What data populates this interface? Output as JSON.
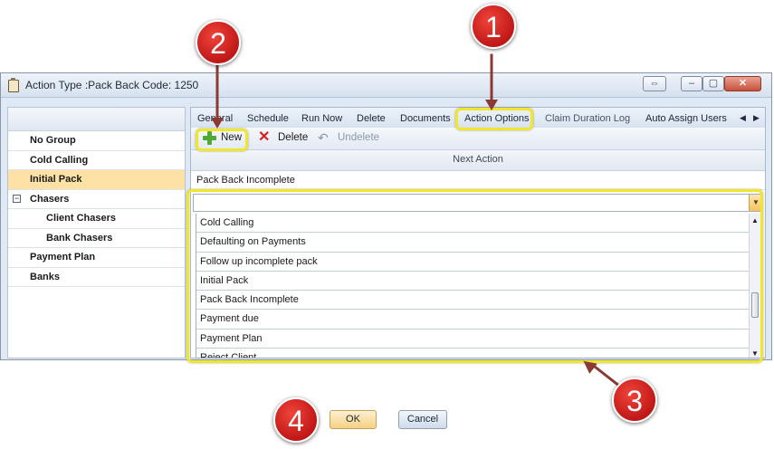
{
  "window": {
    "title": "Action Type :Pack Back Code: 1250"
  },
  "title_buttons": {
    "resize": "⇔",
    "minimize": "–",
    "maximize": "▢",
    "close": "✕"
  },
  "sidebar": {
    "items": [
      {
        "label": "No Group",
        "level": 0,
        "selected": false
      },
      {
        "label": "Cold Calling",
        "level": 0,
        "selected": false
      },
      {
        "label": "Initial Pack",
        "level": 0,
        "selected": true
      },
      {
        "label": "Chasers",
        "level": 0,
        "selected": false,
        "expanded": true
      },
      {
        "label": "Client Chasers",
        "level": 1,
        "selected": false
      },
      {
        "label": "Bank Chasers",
        "level": 1,
        "selected": false
      },
      {
        "label": "Payment Plan",
        "level": 0,
        "selected": false
      },
      {
        "label": "Banks",
        "level": 0,
        "selected": false
      }
    ],
    "collapse_symbol": "−"
  },
  "tabs": [
    {
      "label": "General",
      "active": false
    },
    {
      "label": "Schedule",
      "active": false
    },
    {
      "label": "Run Now",
      "active": false
    },
    {
      "label": "Delete",
      "active": false
    },
    {
      "label": "Documents",
      "active": false
    },
    {
      "label": "Action Options",
      "active": true
    },
    {
      "label": "Claim Duration Log",
      "active": false
    },
    {
      "label": "Auto Assign Users",
      "active": false
    }
  ],
  "tab_scroll": {
    "left": "◀",
    "right": "▶"
  },
  "toolbar": {
    "new_label": "New",
    "delete_label": "Delete",
    "undelete_label": "Undelete"
  },
  "grid": {
    "column_header": "Next Action",
    "row_value": "Pack Back Incomplete",
    "combo_value": "",
    "options": [
      "Cold Calling",
      "Defaulting on Payments",
      "Follow up incomplete pack",
      "Initial Pack",
      "Pack Back Incomplete",
      "Payment due",
      "Payment Plan",
      "Reject Client"
    ]
  },
  "callouts": [
    "1",
    "2",
    "3",
    "4"
  ],
  "dialog": {
    "ok_label": "OK",
    "cancel_label": "Cancel"
  },
  "colors": {
    "highlight": "#f0e62c",
    "marker": "#d42a22",
    "selected_row": "#fde1a5"
  }
}
